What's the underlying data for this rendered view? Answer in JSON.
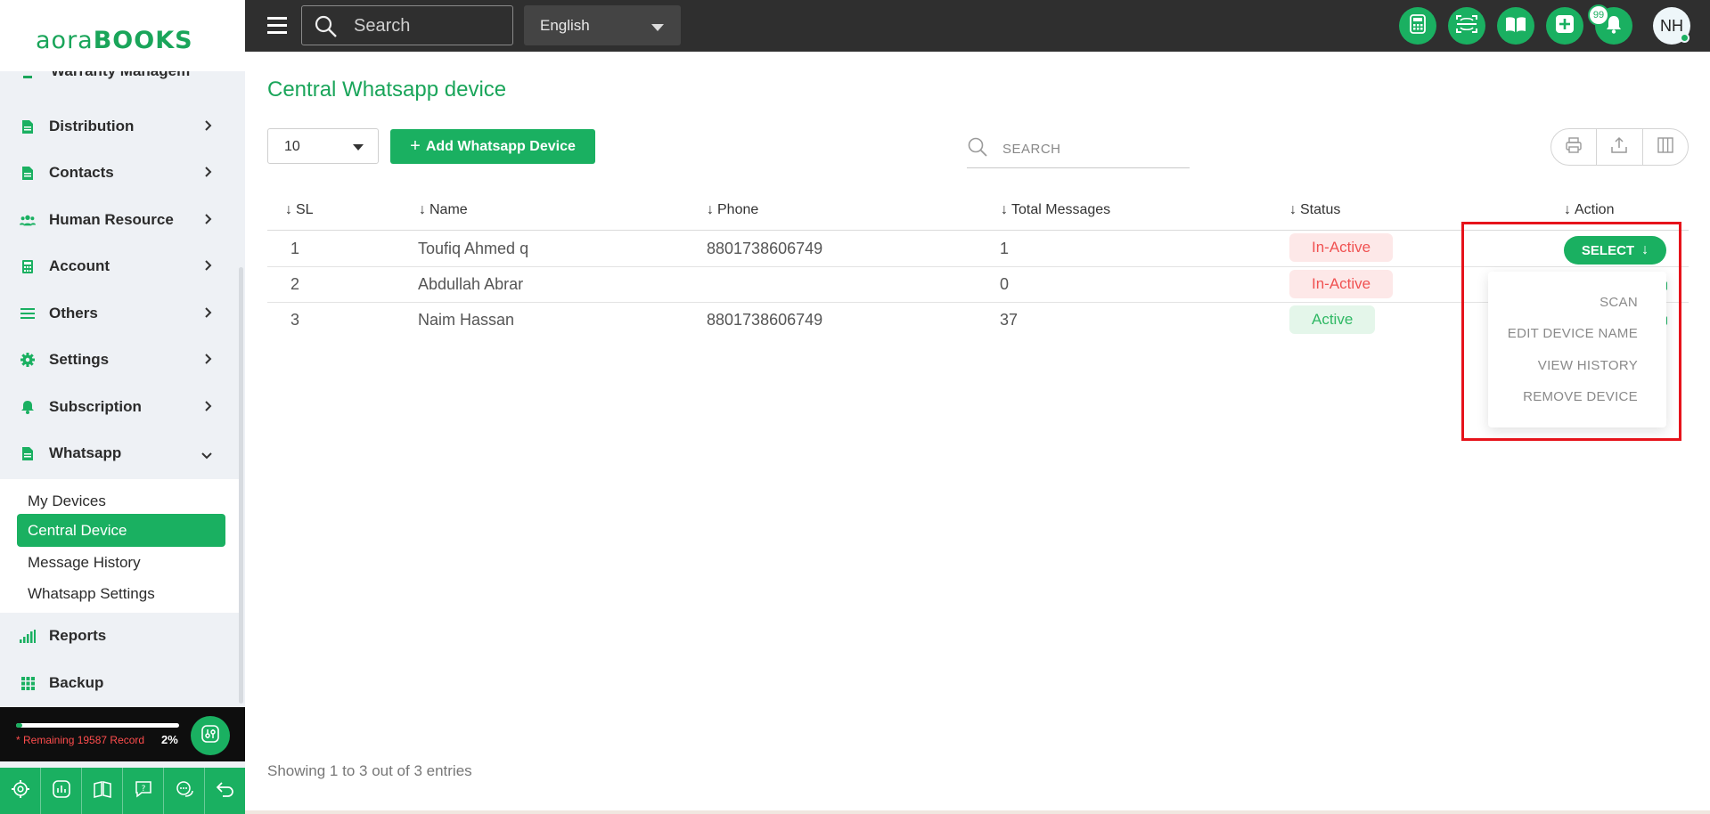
{
  "app": {
    "logo_light": "aora",
    "logo_bold": "BOOKS"
  },
  "sidebar": {
    "cut_item": "Warranty Managem",
    "items": [
      {
        "label": "Distribution",
        "icon": "document-icon"
      },
      {
        "label": "Contacts",
        "icon": "document-icon"
      },
      {
        "label": "Human Resource",
        "icon": "users-icon"
      },
      {
        "label": "Account",
        "icon": "calculator-icon"
      },
      {
        "label": "Others",
        "icon": "list-icon"
      },
      {
        "label": "Settings",
        "icon": "gear-icon"
      },
      {
        "label": "Subscription",
        "icon": "bell-icon"
      },
      {
        "label": "Whatsapp",
        "icon": "document-icon"
      }
    ],
    "whatsapp_submenu": [
      {
        "label": "My Devices",
        "active": false
      },
      {
        "label": "Central Device",
        "active": true
      },
      {
        "label": "Message History",
        "active": false
      },
      {
        "label": "Whatsapp Settings",
        "active": false
      }
    ],
    "after_items": [
      {
        "label": "Reports",
        "icon": "signal-bars-icon"
      },
      {
        "label": "Backup",
        "icon": "grid-icon"
      }
    ],
    "quota": {
      "text": "* Remaining 19587 Record",
      "percent_label": "2%",
      "percent": 2
    }
  },
  "topbar": {
    "search_placeholder": "Search",
    "language": "English",
    "notification_count": "99",
    "avatar_initials": "NH"
  },
  "page": {
    "title": "Central Whatsapp device",
    "page_size": "10",
    "add_button": "Add Whatsapp Device",
    "search_placeholder": "SEARCH",
    "footer": "Showing 1 to 3 out of 3 entries"
  },
  "table": {
    "columns": [
      "SL",
      "Name",
      "Phone",
      "Total Messages",
      "Status",
      "Action"
    ],
    "rows": [
      {
        "sl": "1",
        "name": "Toufiq Ahmed q",
        "phone": "8801738606749",
        "total": "1",
        "status": "In-Active"
      },
      {
        "sl": "2",
        "name": "Abdullah Abrar",
        "phone": "",
        "total": "0",
        "status": "In-Active"
      },
      {
        "sl": "3",
        "name": "Naim Hassan",
        "phone": "8801738606749",
        "total": "37",
        "status": "Active"
      }
    ],
    "action_button": "SELECT",
    "action_menu": [
      "SCAN",
      "EDIT DEVICE NAME",
      "VIEW HISTORY",
      "REMOVE DEVICE"
    ]
  },
  "colors": {
    "brand": "#1ab061",
    "topbar": "#2f2f2f",
    "inactive_text": "#f05252",
    "active_text": "#2fb864",
    "highlight": "#e6131b"
  }
}
